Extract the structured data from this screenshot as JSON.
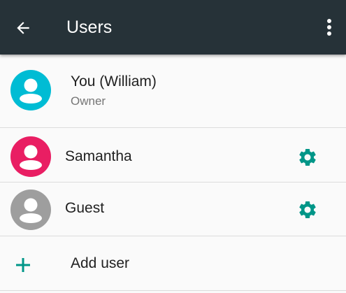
{
  "appbar": {
    "title": "Users",
    "back_icon": "arrow-left-icon",
    "menu_icon": "more-vert-icon",
    "background": "#263238"
  },
  "users": {
    "owner": {
      "name": "You",
      "name_detail": "(William)",
      "subtitle": "Owner",
      "avatar_color": "#00bcd4"
    },
    "samantha": {
      "name": "Samantha",
      "avatar_color": "#e91e63",
      "settings_icon": "gear-icon"
    },
    "guest": {
      "name": "Guest",
      "avatar_color": "#9e9e9e",
      "settings_icon": "gear-icon"
    }
  },
  "add_user": {
    "label": "Add user",
    "icon": "plus-icon"
  },
  "colors": {
    "accent": "#009688"
  }
}
